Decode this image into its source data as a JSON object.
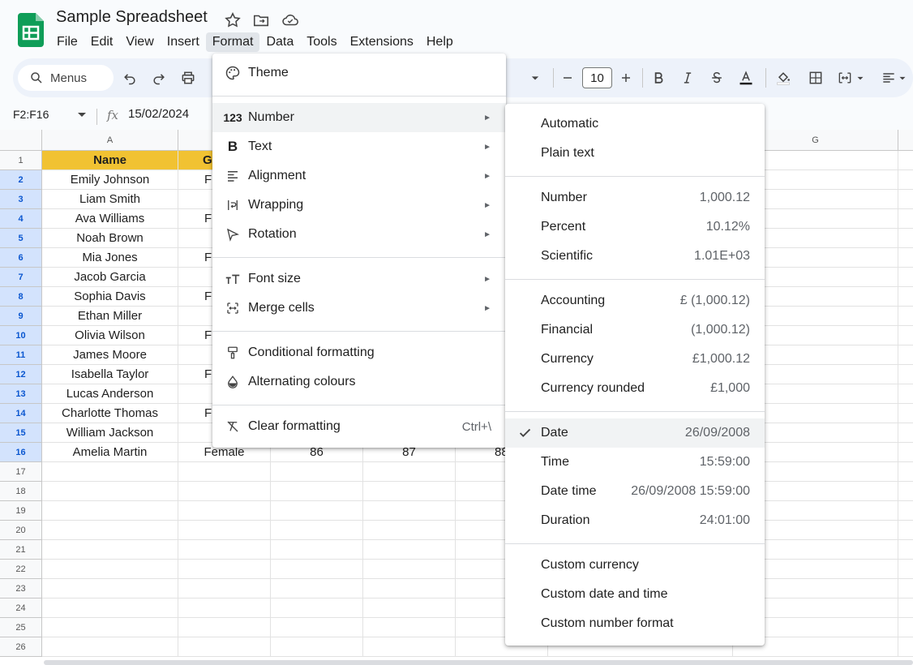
{
  "app": {
    "title": "Sample Spreadsheet"
  },
  "menubar": [
    "File",
    "Edit",
    "View",
    "Insert",
    "Format",
    "Data",
    "Tools",
    "Extensions",
    "Help"
  ],
  "toolbar": {
    "search_label": "Menus",
    "font_size": "10"
  },
  "formula_bar": {
    "name_box": "F2:F16",
    "fx": "fx",
    "value": "15/02/2024"
  },
  "grid": {
    "visible_columns": [
      "A",
      "G"
    ],
    "row_numbers": [
      "1",
      "2",
      "3",
      "4",
      "5",
      "6",
      "7",
      "8",
      "9",
      "10",
      "11",
      "12",
      "13",
      "14",
      "15",
      "16",
      "17",
      "18",
      "19",
      "20",
      "21",
      "22",
      "23",
      "24",
      "25",
      "26"
    ],
    "header_row": [
      "Name",
      "G"
    ],
    "names": [
      "Emily Johnson",
      "Liam Smith",
      "Ava Williams",
      "Noah Brown",
      "Mia Jones",
      "Jacob Garcia",
      "Sophia Davis",
      "Ethan Miller",
      "Olivia Wilson",
      "James Moore",
      "Isabella Taylor",
      "Lucas Anderson",
      "Charlotte Thomas",
      "William Jackson",
      "Amelia Martin"
    ],
    "col_b_partial": [
      "F",
      "",
      "F",
      "",
      "F",
      "",
      "F",
      "",
      "F",
      "",
      "F",
      "",
      "F",
      "",
      ""
    ],
    "row16": {
      "gender": "Female",
      "c": "86",
      "d": "87",
      "e": "88"
    }
  },
  "format_menu": {
    "items": [
      {
        "label": "Theme",
        "icon": "palette-icon"
      },
      {
        "label": "Number",
        "icon": "123",
        "arrow": "►"
      },
      {
        "label": "Text",
        "icon": "B",
        "arrow": "►"
      },
      {
        "label": "Alignment",
        "icon": "align-icon",
        "arrow": "►"
      },
      {
        "label": "Wrapping",
        "icon": "wrap-icon",
        "arrow": "►"
      },
      {
        "label": "Rotation",
        "icon": "rotation-icon",
        "arrow": "►"
      },
      {
        "label": "Font size",
        "icon": "font-size-icon",
        "arrow": "►"
      },
      {
        "label": "Merge cells",
        "icon": "merge-icon",
        "arrow": "►"
      },
      {
        "label": "Conditional formatting",
        "icon": "paint-roller-icon"
      },
      {
        "label": "Alternating colours",
        "icon": "drop-icon"
      },
      {
        "label": "Clear formatting",
        "icon": "clear-format-icon",
        "shortcut": "Ctrl+\\"
      }
    ]
  },
  "number_menu": {
    "items": [
      {
        "label": "Automatic",
        "example": ""
      },
      {
        "label": "Plain text",
        "example": ""
      },
      {
        "label": "Number",
        "example": "1,000.12"
      },
      {
        "label": "Percent",
        "example": "10.12%"
      },
      {
        "label": "Scientific",
        "example": "1.01E+03"
      },
      {
        "label": "Accounting",
        "example": "£ (1,000.12)"
      },
      {
        "label": "Financial",
        "example": "(1,000.12)"
      },
      {
        "label": "Currency",
        "example": "£1,000.12"
      },
      {
        "label": "Currency rounded",
        "example": "£1,000"
      },
      {
        "label": "Date",
        "example": "26/09/2008",
        "checked": true
      },
      {
        "label": "Time",
        "example": "15:59:00"
      },
      {
        "label": "Date time",
        "example": "26/09/2008 15:59:00"
      },
      {
        "label": "Duration",
        "example": "24:01:00"
      },
      {
        "label": "Custom currency",
        "example": ""
      },
      {
        "label": "Custom date and time",
        "example": ""
      },
      {
        "label": "Custom number format",
        "example": ""
      }
    ]
  },
  "colors": {
    "accent": "#0b57d0",
    "header_fill": "#f1c232",
    "sheets_green": "#0f9d58"
  }
}
